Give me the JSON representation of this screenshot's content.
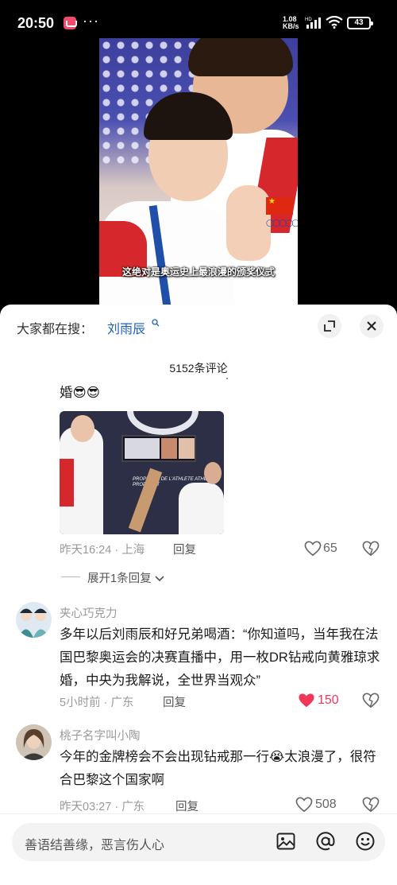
{
  "status_bar": {
    "time": "20:50",
    "net_speed_value": "1.08",
    "net_speed_unit": "KB/s",
    "hd": "HD",
    "battery": "43"
  },
  "video": {
    "caption": "这绝对是奥运史上最浪漫的颁奖仪式"
  },
  "search": {
    "prefix": "大家都在搜：",
    "term": "刘雨辰"
  },
  "comments_header": {
    "count": "5152条评论"
  },
  "comment1": {
    "text_tail": "婚😎😎",
    "time": "昨天16:24",
    "location": "上海",
    "reply": "回复",
    "likes": "65",
    "image_sign": "PROPMENT DE L'ATHLETE ATHLETE PROPMENT",
    "expand": "展开1条回复"
  },
  "comment2": {
    "user": "夹心巧克力",
    "text": "多年以后刘雨辰和好兄弟喝酒：“你知道吗，当年我在法国巴黎奥运会的决赛直播中，用一枚DR钻戒向黄雅琼求婚，中央为我解说，全世界当观众”",
    "time": "5小时前",
    "location": "广东",
    "reply": "回复",
    "likes": "150"
  },
  "comment3": {
    "user": "桃子名字叫小陶",
    "text": "今年的金牌榜会不会出现钻戒那一行😭太浪漫了，很符合巴黎这个国家啊",
    "time": "昨天03:27",
    "location": "广东",
    "reply": "回复",
    "likes": "508"
  },
  "input": {
    "placeholder": "善语结善缘，恶言伤人心"
  },
  "colors": {
    "accent_blue": "#1f5fb8",
    "liked_red": "#f0375a"
  }
}
